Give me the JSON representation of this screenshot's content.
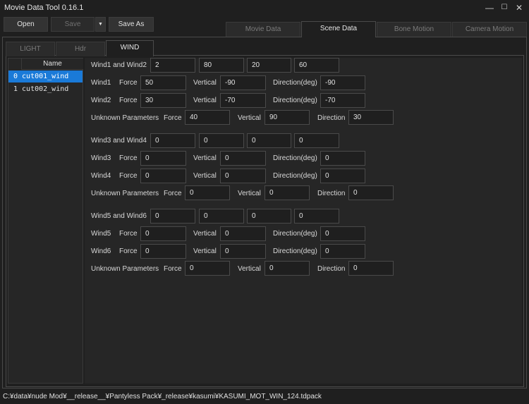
{
  "app": {
    "title": "Movie Data Tool 0.16.1"
  },
  "window_controls": {
    "minimize": "—",
    "maximize": "☐",
    "close": "✕"
  },
  "toolbar": {
    "open": "Open",
    "save": "Save",
    "dropdown_arrow": "▼",
    "save_as": "Save As"
  },
  "main_tabs": [
    "Movie Data",
    "Scene Data",
    "Bone Motion",
    "Camera Motion"
  ],
  "sub_tabs": [
    "LIGHT",
    "Hdr",
    "WIND"
  ],
  "list": {
    "header": "Name",
    "items": [
      "0 cut001_wind",
      "1 cut002_wind"
    ]
  },
  "labels": {
    "force": "Force",
    "vertical": "Vertical",
    "direction_deg": "Direction(deg)",
    "direction": "Direction",
    "unknown": "Unknown Parameters"
  },
  "groups": [
    {
      "pair_label": "Wind1 and Wind2",
      "pair_values": [
        "2",
        "80",
        "20",
        "60"
      ],
      "rows": [
        {
          "label": "Wind1",
          "force": "50",
          "vertical": "-90",
          "direction": "-90"
        },
        {
          "label": "Wind2",
          "force": "30",
          "vertical": "-70",
          "direction": "-70"
        }
      ],
      "unknown": {
        "force": "40",
        "vertical": "90",
        "direction": "30"
      }
    },
    {
      "pair_label": "Wind3 and Wind4",
      "pair_values": [
        "0",
        "0",
        "0",
        "0"
      ],
      "rows": [
        {
          "label": "Wind3",
          "force": "0",
          "vertical": "0",
          "direction": "0"
        },
        {
          "label": "Wind4",
          "force": "0",
          "vertical": "0",
          "direction": "0"
        }
      ],
      "unknown": {
        "force": "0",
        "vertical": "0",
        "direction": "0"
      }
    },
    {
      "pair_label": "Wind5 and Wind6",
      "pair_values": [
        "0",
        "0",
        "0",
        "0"
      ],
      "rows": [
        {
          "label": "Wind5",
          "force": "0",
          "vertical": "0",
          "direction": "0"
        },
        {
          "label": "Wind6",
          "force": "0",
          "vertical": "0",
          "direction": "0"
        }
      ],
      "unknown": {
        "force": "0",
        "vertical": "0",
        "direction": "0"
      }
    }
  ],
  "status": {
    "path": "C:¥data¥nude Mod¥__release__¥Pantyless Pack¥_release¥kasumi¥KASUMI_MOT_WIN_124.tdpack"
  }
}
